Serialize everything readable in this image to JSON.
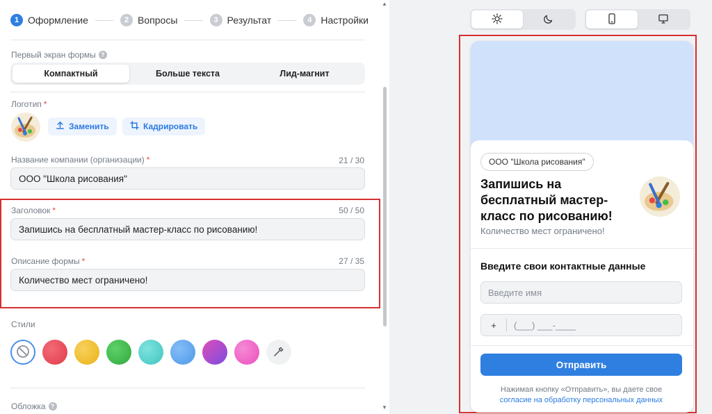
{
  "steps": [
    {
      "num": "1",
      "label": "Оформление"
    },
    {
      "num": "2",
      "label": "Вопросы"
    },
    {
      "num": "3",
      "label": "Результат"
    },
    {
      "num": "4",
      "label": "Настройки"
    }
  ],
  "first_screen": {
    "label": "Первый экран формы",
    "options": [
      "Компактный",
      "Больше текста",
      "Лид-магнит"
    ],
    "selected": "Компактный"
  },
  "logo": {
    "label": "Логотип",
    "replace_label": "Заменить",
    "crop_label": "Кадрировать"
  },
  "company": {
    "label": "Название компании (организации)",
    "counter": "21 / 30",
    "value": "ООО \"Школа рисования\""
  },
  "headline": {
    "label": "Заголовок",
    "counter": "50 / 50",
    "value": "Запишись на бесплатный мастер-класс по рисованию!"
  },
  "description": {
    "label": "Описание формы",
    "counter": "27 / 35",
    "value": "Количество мест ограничено!"
  },
  "styles": {
    "label": "Стили",
    "swatches": [
      "none",
      "#e8515f",
      "#f2c12e",
      "#3fbf4a",
      "#4fd3cf",
      "#5ea8f2",
      "#a84de0",
      "#f064c8",
      "picker"
    ]
  },
  "cover": {
    "label": "Обложка"
  },
  "preview": {
    "company": "ООО \"Школа рисования\"",
    "headline": "Запишись на бесплатный мастер-класс по рисованию!",
    "subline": "Количество мест ограничено!",
    "contact_title": "Введите свои контактные данные",
    "name_placeholder": "Введите имя",
    "phone_plus": "+",
    "phone_mask": "(___) ___-____",
    "submit": "Отправить",
    "consent_text": "Нажимая кнопку «Отправить», вы даете свое",
    "consent_link": "согласие на обработку персональных данных"
  },
  "colors": {
    "accent": "#2f7fe0",
    "highlight": "#d62f2f",
    "cover": "#cfe1fb"
  },
  "icons": [
    "sun-icon",
    "moon-icon",
    "phone-icon",
    "desktop-icon",
    "upload-icon",
    "crop-icon",
    "help-icon",
    "no-style-icon",
    "eyedropper-icon"
  ]
}
